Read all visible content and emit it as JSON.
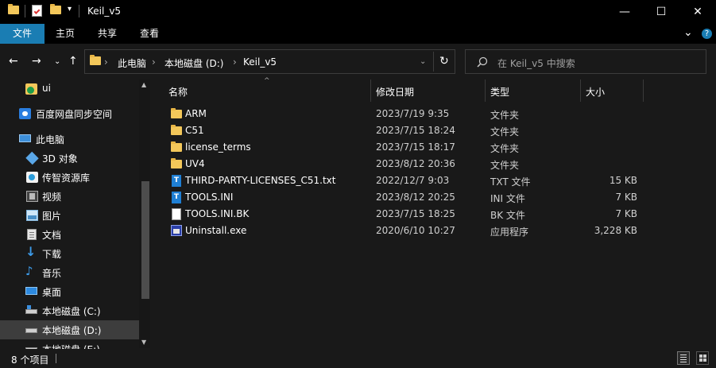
{
  "window": {
    "title": "Keil_v5",
    "minimize_glyph": "—",
    "maximize_glyph": "☐",
    "close_glyph": "✕"
  },
  "ribbon": {
    "tabs": [
      {
        "label": "文件"
      },
      {
        "label": "主页"
      },
      {
        "label": "共享"
      },
      {
        "label": "查看"
      }
    ],
    "expand_glyph": "⌄",
    "help_glyph": "?"
  },
  "address": {
    "crumbs": [
      "此电脑",
      "本地磁盘 (D:)",
      "Keil_v5"
    ],
    "separator": "›",
    "search_placeholder": "在 Keil_v5 中搜索"
  },
  "nav": {
    "items": [
      {
        "label": "ui",
        "icon": "ui-folder-icon"
      },
      {
        "label": "百度网盘同步空间",
        "icon": "baidu-cloud-icon"
      },
      {
        "label": "此电脑",
        "icon": "this-pc-icon"
      },
      {
        "label": "3D 对象",
        "icon": "3d-objects-icon"
      },
      {
        "label": "传智资源库",
        "icon": "library-icon"
      },
      {
        "label": "视频",
        "icon": "video-icon"
      },
      {
        "label": "图片",
        "icon": "pictures-icon"
      },
      {
        "label": "文档",
        "icon": "documents-icon"
      },
      {
        "label": "下载",
        "icon": "downloads-icon"
      },
      {
        "label": "音乐",
        "icon": "music-icon"
      },
      {
        "label": "桌面",
        "icon": "desktop-icon"
      },
      {
        "label": "本地磁盘 (C:)",
        "icon": "drive-c-icon"
      },
      {
        "label": "本地磁盘 (D:)",
        "icon": "drive-d-icon"
      },
      {
        "label": "本地磁盘 (E:)",
        "icon": "drive-e-icon"
      }
    ]
  },
  "columns": {
    "name": "名称",
    "modified": "修改日期",
    "type": "类型",
    "size": "大小"
  },
  "files": [
    {
      "name": "ARM",
      "modified": "2023/7/19 9:35",
      "type": "文件夹",
      "size": "",
      "icon": "folder"
    },
    {
      "name": "C51",
      "modified": "2023/7/15 18:24",
      "type": "文件夹",
      "size": "",
      "icon": "folder"
    },
    {
      "name": "license_terms",
      "modified": "2023/7/15 18:17",
      "type": "文件夹",
      "size": "",
      "icon": "folder"
    },
    {
      "name": "UV4",
      "modified": "2023/8/12 20:36",
      "type": "文件夹",
      "size": "",
      "icon": "folder"
    },
    {
      "name": "THIRD-PARTY-LICENSES_C51.txt",
      "modified": "2022/12/7 9:03",
      "type": "TXT 文件",
      "size": "15 KB",
      "icon": "text"
    },
    {
      "name": "TOOLS.INI",
      "modified": "2023/8/12 20:25",
      "type": "INI 文件",
      "size": "7 KB",
      "icon": "ini"
    },
    {
      "name": "TOOLS.INI.BK",
      "modified": "2023/7/15 18:25",
      "type": "BK 文件",
      "size": "7 KB",
      "icon": "blank"
    },
    {
      "name": "Uninstall.exe",
      "modified": "2020/6/10 10:27",
      "type": "应用程序",
      "size": "3,228 KB",
      "icon": "exe"
    }
  ],
  "status": {
    "count_text": "8 个项目"
  },
  "colors": {
    "accent": "#1a7db3",
    "folder": "#f3c75a",
    "background": "#191919"
  }
}
